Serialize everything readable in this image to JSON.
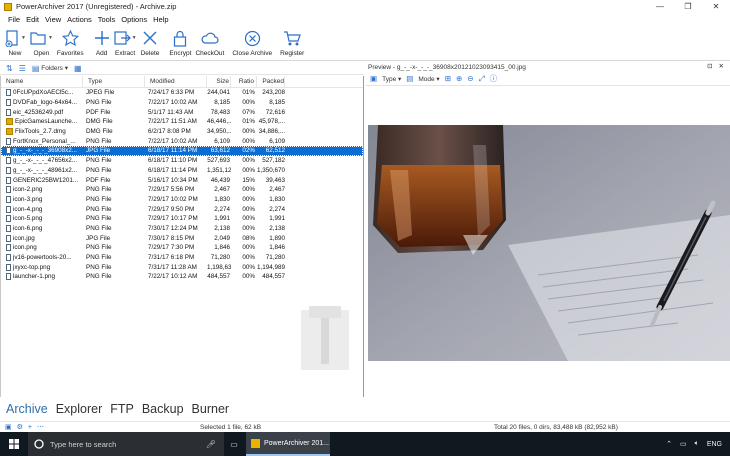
{
  "window": {
    "title": "PowerArchiver 2017 (Unregistered) - Archive.zip",
    "controls": [
      "—",
      "❐",
      "✕"
    ]
  },
  "menu": [
    "File",
    "Edit",
    "View",
    "Actions",
    "Tools",
    "Options",
    "Help"
  ],
  "ribbon": {
    "new": "New",
    "open": "Open",
    "favorites": "Favorites",
    "add": "Add",
    "extract": "Extract",
    "delete": "Delete",
    "encrypt": "Encrypt",
    "checkout": "CheckOut",
    "close_archive": "Close Archive",
    "register": "Register"
  },
  "subtoolbar": {
    "folders": "Folders"
  },
  "columns": {
    "name": "Name",
    "type": "Type",
    "modified": "Modified",
    "size": "Size",
    "ratio": "Ratio",
    "packed": "Packed"
  },
  "files": [
    {
      "name": "0FcUPpdXoAECl5c...",
      "type": "JPEG File",
      "modified": "7/24/17 6:33 PM",
      "size": "244,041",
      "ratio": "01%",
      "packed": "243,208",
      "kind": "file"
    },
    {
      "name": "DVDFab_logo-64x64...",
      "type": "PNG File",
      "modified": "7/22/17 10:02 AM",
      "size": "8,185",
      "ratio": "00%",
      "packed": "8,185",
      "kind": "file"
    },
    {
      "name": "eic_42536249.pdf",
      "type": "PDF File",
      "modified": "5/1/17 11:43 AM",
      "size": "78,483",
      "ratio": "07%",
      "packed": "72,616",
      "kind": "file"
    },
    {
      "name": "EpicGamesLaunche...",
      "type": "DMG File",
      "modified": "7/22/17 11:51 AM",
      "size": "46,446,...",
      "ratio": "01%",
      "packed": "45,978,...",
      "kind": "folder"
    },
    {
      "name": "FlixTools_2.7.dmg",
      "type": "DMG File",
      "modified": "6/2/17 8:08 PM",
      "size": "34,950,...",
      "ratio": "00%",
      "packed": "34,886,...",
      "kind": "folder"
    },
    {
      "name": "FortKnox_Personal_...",
      "type": "PNG File",
      "modified": "7/22/17 10:02 AM",
      "size": "6,109",
      "ratio": "00%",
      "packed": "6,109",
      "kind": "file"
    },
    {
      "name": "g_-_-x-_-_-_36908x2...",
      "type": "JPG File",
      "modified": "6/18/17 11:14 PM",
      "size": "63,612",
      "ratio": "02%",
      "packed": "62,512",
      "kind": "file",
      "selected": true
    },
    {
      "name": "g_-_-x-_-_-_47656x2...",
      "type": "PNG File",
      "modified": "6/18/17 11:10 PM",
      "size": "527,693",
      "ratio": "00%",
      "packed": "527,182",
      "kind": "file"
    },
    {
      "name": "g_-_-x-_-_-_48961x2...",
      "type": "PNG File",
      "modified": "6/18/17 11:14 PM",
      "size": "1,351,128",
      "ratio": "00%",
      "packed": "1,350,670",
      "kind": "file"
    },
    {
      "name": "GENERIC25BW1201...",
      "type": "PDF File",
      "modified": "5/16/17 10:34 PM",
      "size": "46,439",
      "ratio": "15%",
      "packed": "39,463",
      "kind": "file"
    },
    {
      "name": "icon-2.png",
      "type": "PNG File",
      "modified": "7/29/17 5:56 PM",
      "size": "2,467",
      "ratio": "00%",
      "packed": "2,467",
      "kind": "file"
    },
    {
      "name": "icon-3.png",
      "type": "PNG File",
      "modified": "7/29/17 10:02 PM",
      "size": "1,830",
      "ratio": "00%",
      "packed": "1,830",
      "kind": "file"
    },
    {
      "name": "icon-4.png",
      "type": "PNG File",
      "modified": "7/29/17 9:50 PM",
      "size": "2,274",
      "ratio": "00%",
      "packed": "2,274",
      "kind": "file"
    },
    {
      "name": "icon-5.png",
      "type": "PNG File",
      "modified": "7/29/17 10:17 PM",
      "size": "1,991",
      "ratio": "00%",
      "packed": "1,991",
      "kind": "file"
    },
    {
      "name": "icon-6.png",
      "type": "PNG File",
      "modified": "7/30/17 12:24 PM",
      "size": "2,138",
      "ratio": "00%",
      "packed": "2,138",
      "kind": "file"
    },
    {
      "name": "icon.jpg",
      "type": "JPG File",
      "modified": "7/30/17 8:15 PM",
      "size": "2,049",
      "ratio": "08%",
      "packed": "1,890",
      "kind": "file"
    },
    {
      "name": "icon.png",
      "type": "PNG File",
      "modified": "7/29/17 7:30 PM",
      "size": "1,846",
      "ratio": "00%",
      "packed": "1,846",
      "kind": "file"
    },
    {
      "name": "jv16-powertools-20...",
      "type": "PNG File",
      "modified": "7/31/17 6:18 PM",
      "size": "71,280",
      "ratio": "00%",
      "packed": "71,280",
      "kind": "file"
    },
    {
      "name": "jxyxc-top.png",
      "type": "PNG File",
      "modified": "7/31/17 11:28 AM",
      "size": "1,198,631",
      "ratio": "00%",
      "packed": "1,194,989",
      "kind": "file"
    },
    {
      "name": "launcher-1.png",
      "type": "PNG File",
      "modified": "7/22/17 10:12 AM",
      "size": "484,557",
      "ratio": "00%",
      "packed": "484,557",
      "kind": "file"
    }
  ],
  "preview": {
    "title": "Preview - g_-_-x-_-_-_36908x20121023093415_00.jpg",
    "type_label": "Type",
    "mode_label": "Mode",
    "ctrls": [
      "⊡",
      "✕"
    ]
  },
  "bottom_tabs": [
    "Archive",
    "Explorer",
    "FTP",
    "Backup",
    "Burner"
  ],
  "status": {
    "selected": "Selected 1 file, 62 kB",
    "total": "Total 20 files, 0 dirs, 83,488 kB (82,952 kB)"
  },
  "taskbar": {
    "search_placeholder": "Type here to search",
    "app_label": "PowerArchiver 201...",
    "lang": "ENG"
  },
  "colors": {
    "accent": "#0a6dd6",
    "tab_active": "#2d6ea8",
    "taskbar": "#101820"
  }
}
